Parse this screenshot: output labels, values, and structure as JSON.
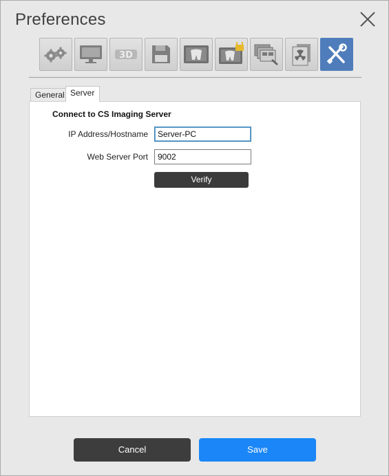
{
  "window": {
    "title": "Preferences"
  },
  "toolbar": {
    "items": [
      {
        "icon": "gears-icon"
      },
      {
        "icon": "monitor-icon"
      },
      {
        "icon": "3d-icon",
        "label": "3D"
      },
      {
        "icon": "floppy-disk-icon"
      },
      {
        "icon": "dental-xray-icon"
      },
      {
        "icon": "dental-lock-icon"
      },
      {
        "icon": "image-stack-icon"
      },
      {
        "icon": "radiation-document-icon"
      },
      {
        "icon": "tools-icon",
        "active": true
      }
    ]
  },
  "tabs": {
    "general": "General",
    "server": "Server"
  },
  "server": {
    "section_title": "Connect to CS Imaging Server",
    "ip_label": "IP Address/Hostname",
    "ip_value": "Server-PC",
    "port_label": "Web Server Port",
    "port_value": "9002",
    "verify_label": "Verify"
  },
  "footer": {
    "cancel_label": "Cancel",
    "save_label": "Save"
  },
  "colors": {
    "active_tool": "#4f7dbb",
    "save_button": "#1a86f7",
    "dark_button": "#3d3d3d"
  }
}
